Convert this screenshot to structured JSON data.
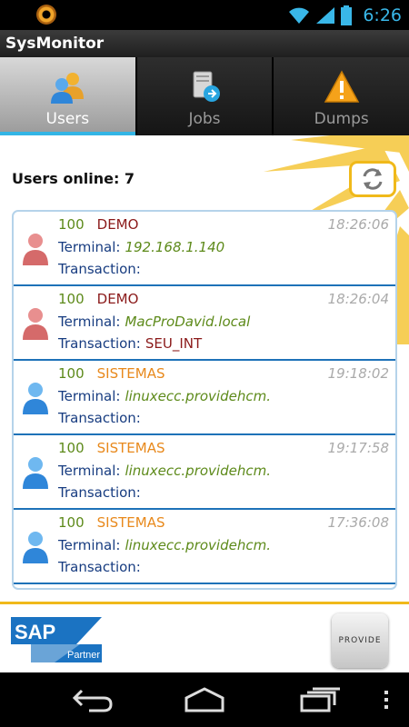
{
  "status_bar": {
    "time": "6:26"
  },
  "app": {
    "title": "SysMonitor"
  },
  "tabs": [
    {
      "label": "Users",
      "icon": "users-icon",
      "active": true
    },
    {
      "label": "Jobs",
      "icon": "jobs-icon",
      "active": false
    },
    {
      "label": "Dumps",
      "icon": "warning-icon",
      "active": false
    }
  ],
  "users_online": {
    "label": "Users online:",
    "count": "7"
  },
  "field_labels": {
    "terminal": "Terminal:",
    "transaction": "Transaction:"
  },
  "sessions": [
    {
      "client": "100",
      "user": "DEMO",
      "time": "18:26:06",
      "terminal": "192.168.1.140",
      "transaction": "",
      "status": "inactive"
    },
    {
      "client": "100",
      "user": "DEMO",
      "time": "18:26:04",
      "terminal": "MacProDavid.local",
      "transaction": "SEU_INT",
      "status": "inactive"
    },
    {
      "client": "100",
      "user": "SISTEMAS",
      "time": "19:18:02",
      "terminal": "linuxecc.providehcm.",
      "transaction": "",
      "status": "active"
    },
    {
      "client": "100",
      "user": "SISTEMAS",
      "time": "19:17:58",
      "terminal": "linuxecc.providehcm.",
      "transaction": "",
      "status": "active"
    },
    {
      "client": "100",
      "user": "SISTEMAS",
      "time": "17:36:08",
      "terminal": "linuxecc.providehcm.",
      "transaction": "",
      "status": "active"
    }
  ],
  "footer": {
    "sap_logo": {
      "brand": "SAP",
      "badge": "Partner"
    },
    "provide_logo": {
      "text": "PROVIDE"
    }
  },
  "colors": {
    "accent": "#33b5e5",
    "brand_yellow": "#f0b91a",
    "list_border": "#1e72b8"
  }
}
